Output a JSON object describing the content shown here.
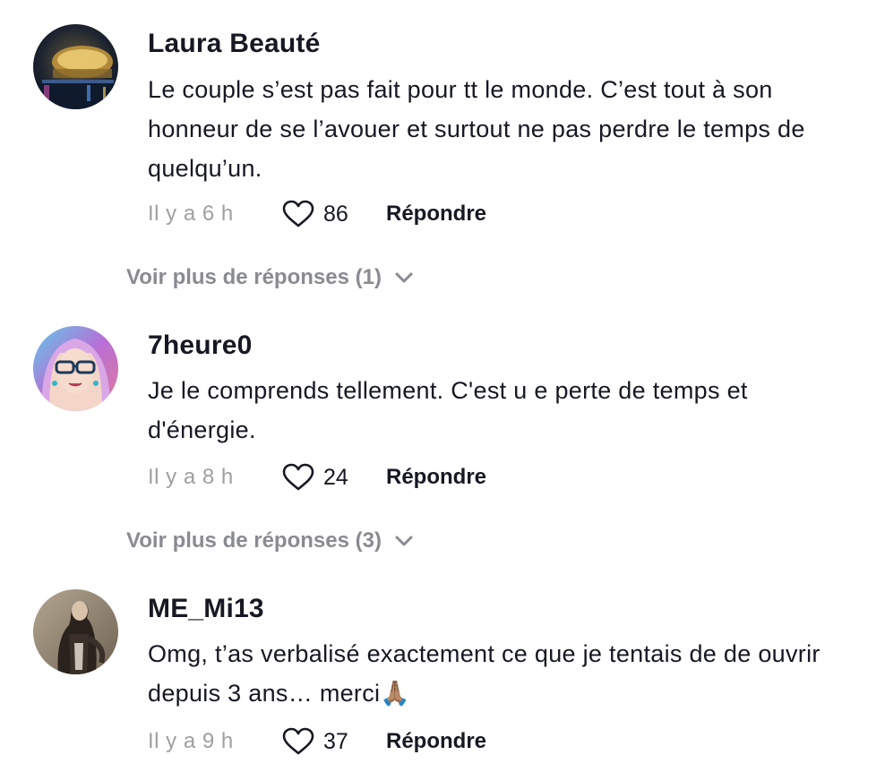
{
  "comments": [
    {
      "username": "Laura Beauté",
      "text": "Le couple s’est pas fait pour tt le monde. C’est tout à son honneur de se l’avouer et surtout ne pas perdre le temps de quelqu’un.",
      "time": "Il y a 6 h",
      "likes": "86",
      "reply_label": "Répondre",
      "more_replies": "Voir plus de réponses (1)"
    },
    {
      "username": "7heure0",
      "text": "Je le comprends tellement. C'est u e perte de temps et d'énergie.",
      "time": "Il y a 8 h",
      "likes": "24",
      "reply_label": "Répondre",
      "more_replies": "Voir plus de réponses (3)"
    },
    {
      "username": "ME_Mi13",
      "text": "Omg, t’as verbalisé exactement ce que je tentais de de ouvrir depuis 3 ans… merci🙏🏽",
      "time": "Il y a 9 h",
      "likes": "37",
      "reply_label": "Répondre"
    }
  ],
  "icons": {
    "like": "heart-outline-icon",
    "expand": "chevron-down-icon"
  },
  "colors": {
    "text_primary": "#161823",
    "text_secondary": "#9e9fa3",
    "more_replies": "#8a8b91"
  }
}
